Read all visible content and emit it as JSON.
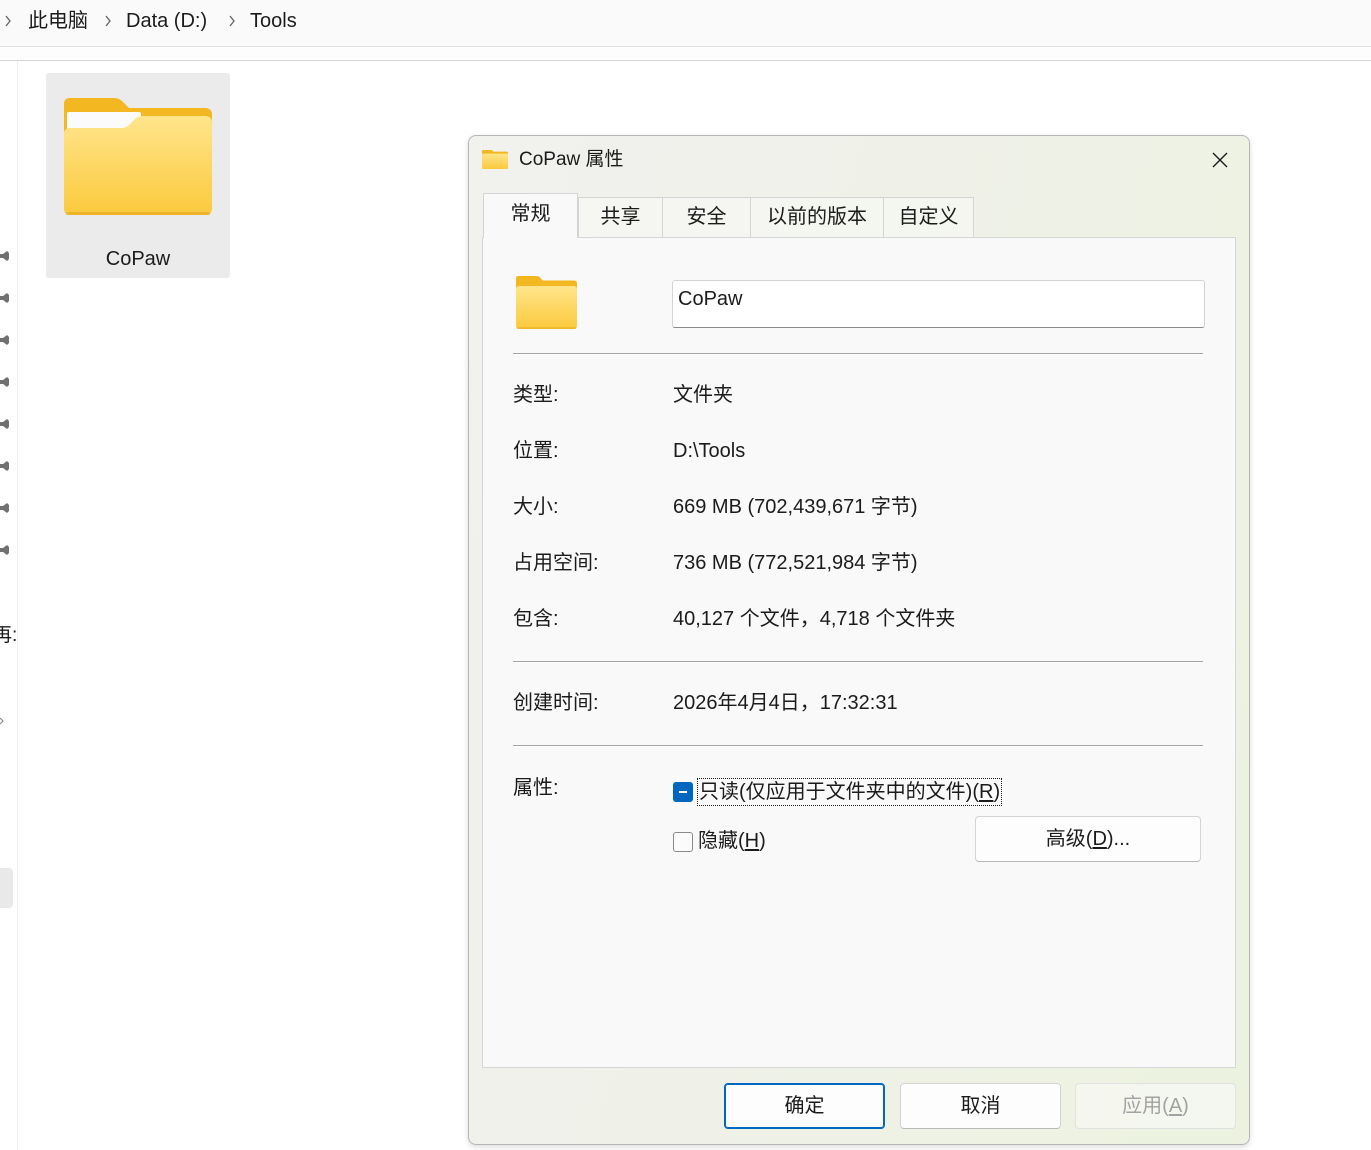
{
  "colors": {
    "accent": "#0067c0",
    "folder_back": "#f3b722",
    "folder_front_top": "#ffe58c",
    "folder_front_bottom": "#fbc93c",
    "tile_selected_bg": "#ebebeb",
    "disabled_text": "#a2a2a2"
  },
  "explorer": {
    "breadcrumb": {
      "items": [
        "此电脑",
        "Data (D:)",
        "Tools"
      ],
      "separator_icon": "chevron-right-icon"
    },
    "sidebar": {
      "pin_icon": "pin-icon",
      "partial_label": "再:"
    },
    "items": [
      {
        "name": "CoPaw",
        "icon": "folder-icon",
        "selected": true
      }
    ]
  },
  "dialog": {
    "title": "CoPaw 属性",
    "title_icon": "folder-icon",
    "close_icon": "close-icon",
    "tabs": [
      {
        "label": "常规",
        "selected": true
      },
      {
        "label": "共享",
        "selected": false
      },
      {
        "label": "安全",
        "selected": false
      },
      {
        "label": "以前的版本",
        "selected": false
      },
      {
        "label": "自定义",
        "selected": false
      }
    ],
    "general": {
      "icon": "folder-icon",
      "name_value": "CoPaw",
      "info_rows": [
        {
          "label": "类型:",
          "value": "文件夹"
        },
        {
          "label": "位置:",
          "value": "D:\\Tools"
        },
        {
          "label": "大小:",
          "value": "669 MB (702,439,671 字节)"
        },
        {
          "label": "占用空间:",
          "value": "736 MB (772,521,984 字节)"
        },
        {
          "label": "包含:",
          "value": "40,127 个文件，4,718 个文件夹"
        }
      ],
      "date_rows": [
        {
          "label": "创建时间:",
          "value": "2026年4月4日，17:32:31"
        }
      ],
      "attributes": {
        "label": "属性:",
        "readonly": {
          "text": "只读(仅应用于文件夹中的文件)(",
          "accel": "R",
          "suffix": ")",
          "checked": false,
          "indeterminate": true,
          "focused": true
        },
        "hidden": {
          "text": "隐藏(",
          "accel": "H",
          "suffix": ")",
          "checked": false,
          "indeterminate": false
        },
        "advanced_button": {
          "text": "高级(",
          "accel": "D",
          "suffix": ")..."
        }
      }
    },
    "buttons": {
      "ok": {
        "label": "确定",
        "default": true
      },
      "cancel": {
        "label": "取消"
      },
      "apply": {
        "text": "应用(",
        "accel": "A",
        "suffix": ")",
        "disabled": true
      }
    }
  }
}
